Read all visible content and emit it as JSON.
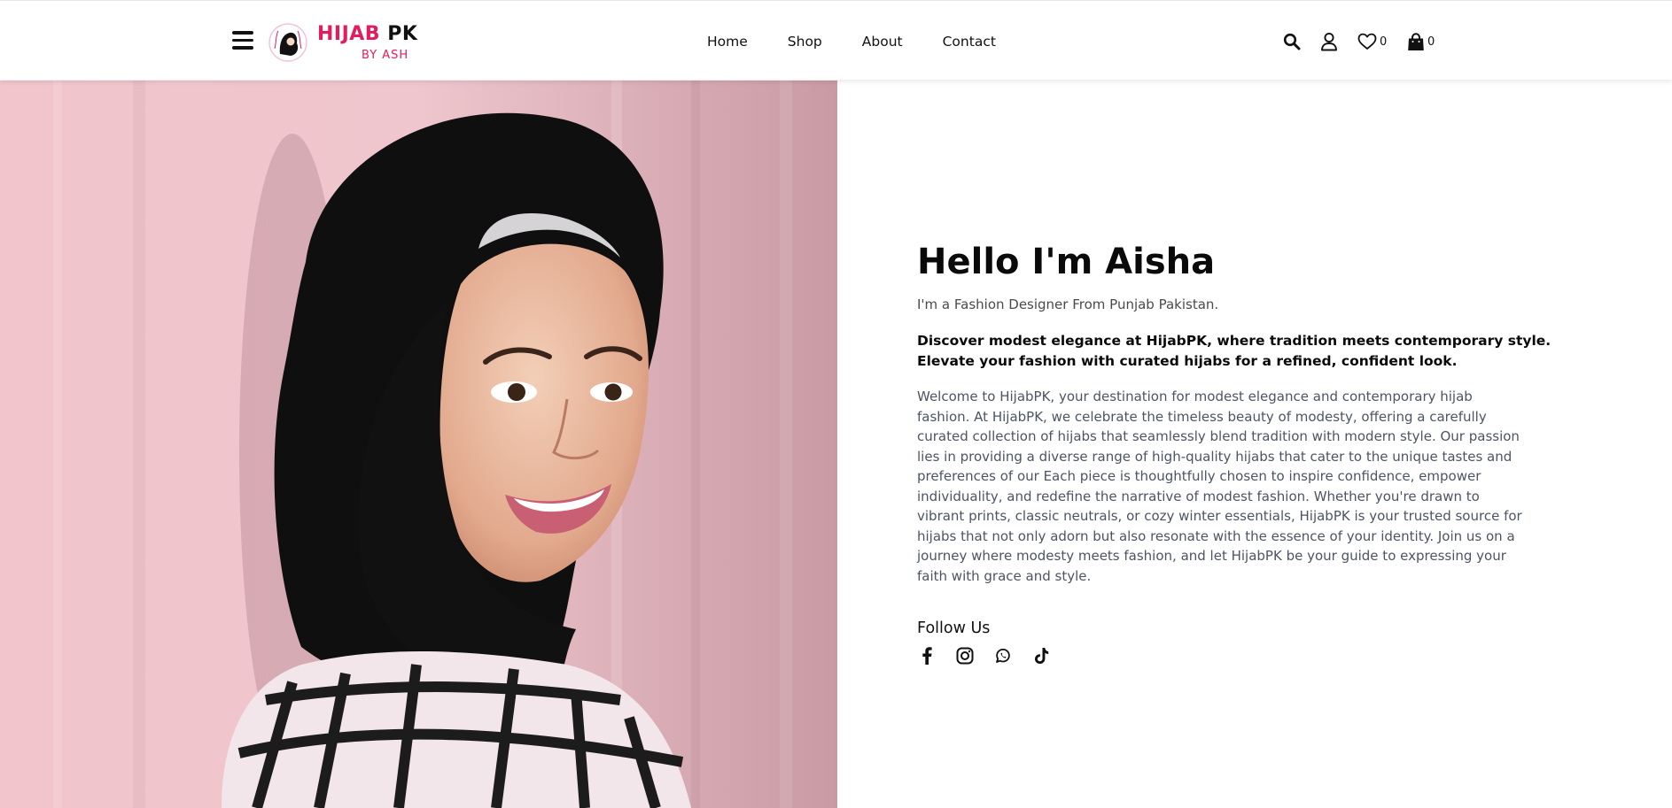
{
  "brand": {
    "name_part1": "HIJAB",
    "name_part2": "PK",
    "tagline": "BY ASH",
    "accent_color": "#e11d5b"
  },
  "nav": {
    "items": [
      {
        "label": "Home"
      },
      {
        "label": "Shop"
      },
      {
        "label": "About"
      },
      {
        "label": "Contact"
      }
    ]
  },
  "header_icons": {
    "search": "search-icon",
    "account": "user-icon",
    "wishlist": {
      "icon": "heart-icon",
      "count": "0"
    },
    "cart": {
      "icon": "shopping-bag-icon",
      "count": "0"
    }
  },
  "hero": {
    "image": "portrait-photo"
  },
  "about": {
    "title": "Hello I'm Aisha",
    "subtitle": "I'm a Fashion Designer From Punjab Pakistan.",
    "lead": "Discover modest elegance at HijabPK, where tradition meets contemporary style. Elevate your fashion with curated hijabs for a refined, confident look.",
    "body": "Welcome to HijabPK, your destination for modest elegance and contemporary hijab fashion. At HijabPK, we celebrate the timeless beauty of modesty, offering a carefully curated collection of hijabs that seamlessly blend tradition with modern style. Our passion lies in providing a diverse range of high-quality hijabs that cater to the unique tastes and preferences of our Each piece is thoughtfully chosen to inspire confidence, empower individuality, and redefine the narrative of modest fashion. Whether you're drawn to vibrant prints, classic neutrals, or cozy winter essentials, HijabPK is your trusted source for hijabs that not only adorn but also resonate with the essence of your identity. Join us on a journey where modesty meets fashion, and let HijabPK be your guide to expressing your faith with grace and style.",
    "follow_label": "Follow Us",
    "social": [
      "facebook-icon",
      "instagram-icon",
      "whatsapp-icon",
      "tiktok-icon"
    ]
  }
}
